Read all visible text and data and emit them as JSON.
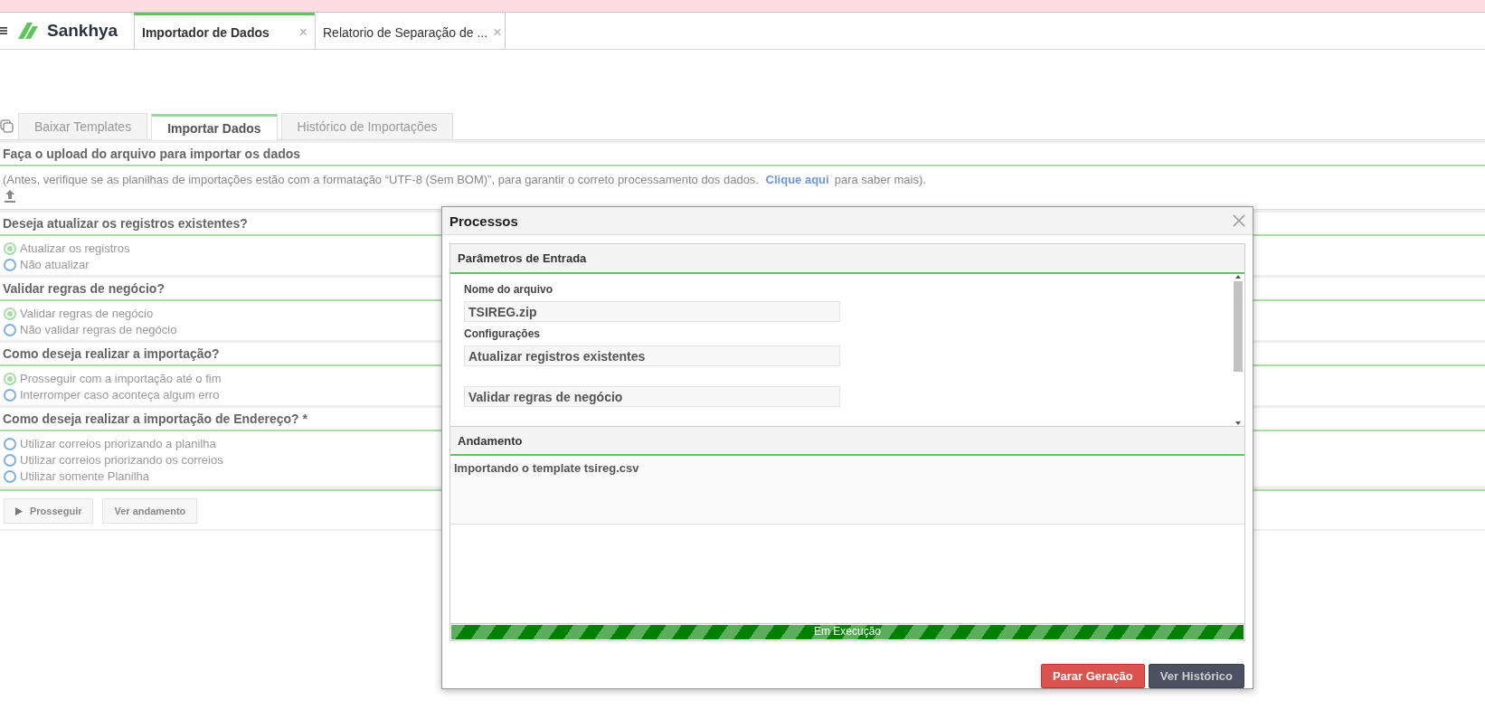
{
  "app_header": {
    "logo": "Sankhya",
    "tabs": [
      {
        "label": "Importador de Dados",
        "selected": true,
        "close": "×"
      },
      {
        "label": "Relatorio de Separação de ...",
        "selected": false,
        "close": "×"
      }
    ]
  },
  "page_tabs": [
    {
      "label": "Baixar Templates",
      "selected": false
    },
    {
      "label": "Importar Dados",
      "selected": true
    },
    {
      "label": "Histórico de Importações",
      "selected": false
    }
  ],
  "upload": {
    "title": "Faça o upload do arquivo para importar os dados",
    "note": "(Antes, verifique se as planilhas de importações estão com a formatação “UTF-8 (Sem BOM)”, para garantir o correto processamento dos dados.",
    "link": "Clique aqui",
    "note_end": "para saber mais)."
  },
  "questions": [
    {
      "title": "Deseja atualizar os registros existentes?",
      "options": [
        {
          "label": "Atualizar os registros",
          "selected": true
        },
        {
          "label": "Não atualizar",
          "selected": false
        }
      ]
    },
    {
      "title": "Validar regras de negócio?",
      "options": [
        {
          "label": "Validar regras de negócio",
          "selected": true
        },
        {
          "label": "Não validar regras de negócio",
          "selected": false
        }
      ]
    },
    {
      "title": "Como deseja realizar a importação?",
      "options": [
        {
          "label": "Prosseguir com a importação até o fim",
          "selected": true
        },
        {
          "label": "Interromper caso aconteça algum erro",
          "selected": false
        }
      ]
    },
    {
      "title": "Como deseja realizar a importação de Endereço? *",
      "options": [
        {
          "label": "Utilizar correios priorizando a planilha",
          "selected": false
        },
        {
          "label": "Utilizar correios priorizando os correios",
          "selected": false
        },
        {
          "label": "Utilizar somente Planilha",
          "selected": false
        }
      ]
    }
  ],
  "actions": [
    "Prosseguir",
    "Ver andamento"
  ],
  "dialog": {
    "title": "Processos",
    "parameters": {
      "title": "Parâmetros de Entrada",
      "fields": [
        {
          "label": "Nome do arquivo",
          "value": "TSIREG.zip"
        },
        {
          "label": "Configurações",
          "value": "Atualizar registros existentes"
        },
        {
          "value": "Validar regras de negócio"
        }
      ]
    },
    "progress": {
      "title": "Andamento",
      "log": "Importando o template tsireg.csv",
      "status": "Em Execução",
      "level": 1
    },
    "buttons": [
      {
        "label": "Parar Geração",
        "kind": "danger"
      },
      {
        "label": "Ver Histórico",
        "kind": "dark"
      }
    ]
  }
}
